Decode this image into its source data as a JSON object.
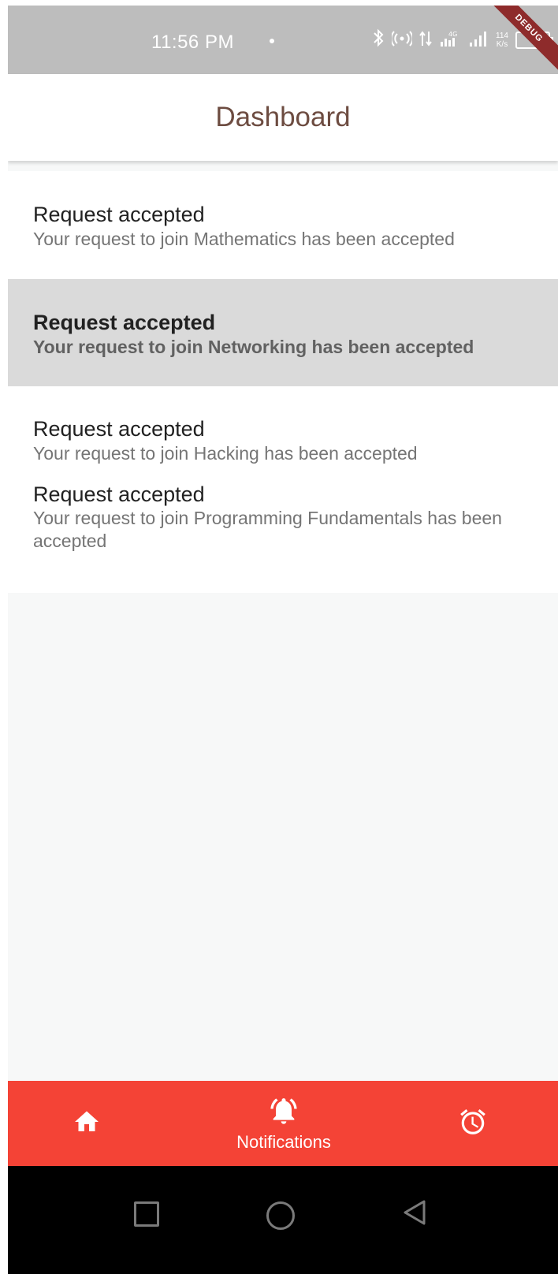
{
  "status_bar": {
    "time": "11:56 PM",
    "net_speed_value": "114",
    "net_speed_unit": "K/s",
    "icons": [
      "dot-icon",
      "bluetooth-icon",
      "hotspot-icon",
      "data-arrows-icon",
      "signal-4g-icon",
      "signal-icon",
      "net-speed-icon",
      "battery-icon"
    ]
  },
  "debug_banner": "DEBUG",
  "app_bar": {
    "title": "Dashboard"
  },
  "notifications": [
    {
      "title": "Request accepted",
      "message": "Your request to join Mathematics has been accepted",
      "highlighted": false
    },
    {
      "title": "Request accepted",
      "message": "Your request to join Networking has been accepted",
      "highlighted": true
    },
    {
      "title": "Request accepted",
      "message": "Your request to join Hacking has been accepted",
      "highlighted": false
    },
    {
      "title": "Request accepted",
      "message": "Your request to join Programming Fundamentals has been accepted",
      "highlighted": false
    }
  ],
  "bottom_nav": {
    "items": [
      {
        "icon": "home-icon",
        "label": ""
      },
      {
        "icon": "notifications-active-icon",
        "label": "Notifications",
        "selected": true
      },
      {
        "icon": "alarm-icon",
        "label": ""
      }
    ]
  },
  "colors": {
    "accent": "#f44336",
    "title": "#6d4c41",
    "highlight_row": "#dadada",
    "status_bar": "#bdbdbd",
    "page_bg": "#f7f8f8"
  },
  "system_nav": [
    "recents-square-icon",
    "home-circle-icon",
    "back-triangle-icon"
  ]
}
